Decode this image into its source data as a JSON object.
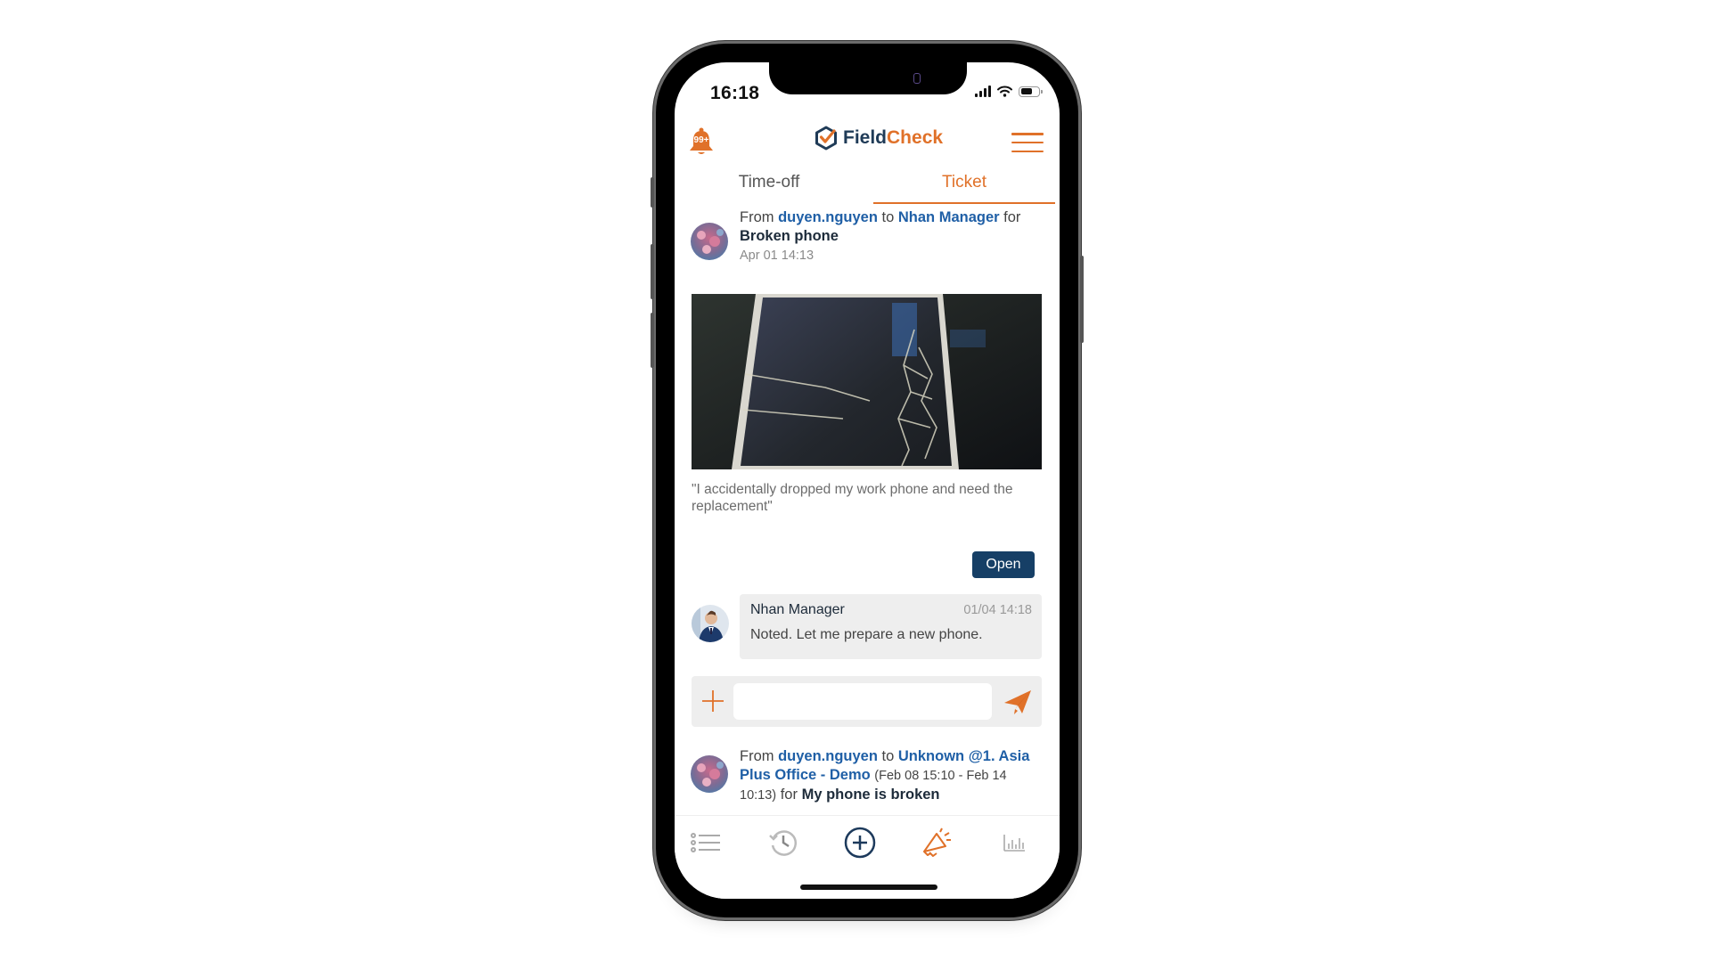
{
  "status_bar": {
    "time": "16:18",
    "battery_level": 0.6
  },
  "header": {
    "notification_badge": "99+",
    "logo_part1": "Field",
    "logo_part2": "Check",
    "brand_colors": {
      "navy": "#1f3b57",
      "orange": "#e07129"
    }
  },
  "tabs": [
    {
      "label": "Time-off",
      "active": false
    },
    {
      "label": "Ticket",
      "active": true
    }
  ],
  "posts": [
    {
      "prefix": "From",
      "from": "duyen.nguyen",
      "to_word": "to",
      "to": "Nhan Manager",
      "for_word": "for",
      "title": "Broken phone",
      "date": "Apr 01 14:13",
      "quote": "\"I accidentally dropped my work phone and need the replacement\"",
      "status_button": "Open",
      "comments": [
        {
          "author": "Nhan Manager",
          "time": "01/04 14:18",
          "text": "Noted. Let me prepare a new phone."
        }
      ],
      "reply_input": {
        "value": "",
        "placeholder": ""
      }
    },
    {
      "prefix": "From",
      "from": "duyen.nguyen",
      "to_word": "to",
      "to": "Unknown @1. Asia Plus Office - Demo",
      "range": "(Feb 08 15:10 - Feb 14 10:13)",
      "for_word": "for",
      "title": "My phone is broken"
    }
  ],
  "bottom_nav": [
    {
      "icon": "list-icon",
      "active": false
    },
    {
      "icon": "history-icon",
      "active": false
    },
    {
      "icon": "add-circle-icon",
      "active": false
    },
    {
      "icon": "megaphone-icon",
      "active": true
    },
    {
      "icon": "bar-chart-icon",
      "active": false
    }
  ]
}
